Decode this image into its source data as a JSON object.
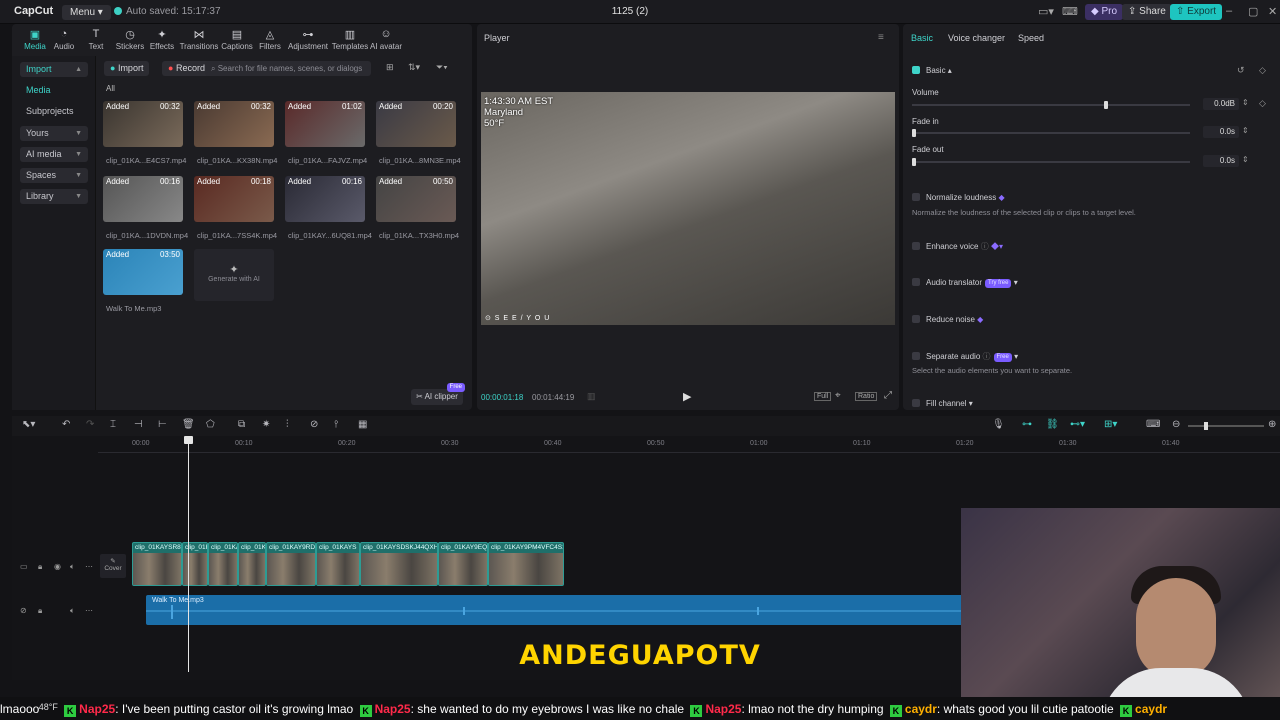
{
  "app": {
    "logo": "CapCut",
    "menu_label": "Menu",
    "saved_status": "Auto saved: 15:17:37",
    "project_title": "1125 (2)",
    "pro_label": "Pro",
    "share_label": "Share",
    "export_label": "Export"
  },
  "toolbar": {
    "items": [
      {
        "label": "Media",
        "icon": "media-icon"
      },
      {
        "label": "Audio",
        "icon": "audio-icon"
      },
      {
        "label": "Text",
        "icon": "text-icon"
      },
      {
        "label": "Stickers",
        "icon": "stickers-icon"
      },
      {
        "label": "Effects",
        "icon": "effects-icon"
      },
      {
        "label": "Transitions",
        "icon": "transitions-icon"
      },
      {
        "label": "Captions",
        "icon": "captions-icon"
      },
      {
        "label": "Filters",
        "icon": "filters-icon"
      },
      {
        "label": "Adjustment",
        "icon": "adjustment-icon"
      },
      {
        "label": "Templates",
        "icon": "templates-icon"
      },
      {
        "label": "AI avatar",
        "icon": "ai-avatar-icon"
      }
    ]
  },
  "sidebar": {
    "items": [
      "Import",
      "Media",
      "Subprojects",
      "Yours",
      "AI media",
      "Spaces",
      "Library"
    ]
  },
  "media": {
    "import_label": "Import",
    "record_label": "Record",
    "search_placeholder": "Search for file names, scenes, or dialogs",
    "filter_all": "All",
    "added_tag": "Added",
    "items": [
      {
        "name": "clip_01KA...E4CS7.mp4",
        "duration": "00:32"
      },
      {
        "name": "clip_01KA...KX38N.mp4",
        "duration": "00:32"
      },
      {
        "name": "clip_01KA...FAJVZ.mp4",
        "duration": "01:02"
      },
      {
        "name": "clip_01KA...8MN3E.mp4",
        "duration": "00:20"
      },
      {
        "name": "clip_01KA...1DVDN.mp4",
        "duration": "00:16"
      },
      {
        "name": "clip_01KA...7SS4K.mp4",
        "duration": "00:18"
      },
      {
        "name": "clip_01KAY...6UQ81.mp4",
        "duration": "00:16"
      },
      {
        "name": "clip_01KA...TX3H0.mp4",
        "duration": "00:50"
      },
      {
        "name": "Walk To Me.mp3",
        "duration": "03:50"
      }
    ],
    "generate_label": "Generate with AI",
    "ai_clipper_label": "AI clipper",
    "ai_clipper_badge": "Free"
  },
  "player": {
    "title": "Player",
    "stamp_time": "1:43:30 AM EST",
    "stamp_place": "Maryland",
    "stamp_temp": "50°F",
    "overlay_text": "⊙ S E E  / Y O U",
    "current_time": "00:00:01:18",
    "total_time": "00:01:44:19",
    "full_label": "Full",
    "ratio_label": "Ratio"
  },
  "props": {
    "tabs": [
      "Basic",
      "Voice changer",
      "Speed"
    ],
    "section": "Basic",
    "volume_label": "Volume",
    "volume_value": "0.0dB",
    "volume_level": 0.69,
    "fade_in_label": "Fade in",
    "fade_in_value": "0.0s",
    "fade_out_label": "Fade out",
    "fade_out_value": "0.0s",
    "normalize_label": "Normalize loudness",
    "normalize_desc": "Normalize the loudness of the selected clip or clips to a target level.",
    "enhance_label": "Enhance voice",
    "translator_label": "Audio translator",
    "translator_badge": "Try free",
    "reduce_label": "Reduce noise",
    "separate_label": "Separate audio",
    "separate_badge": "Free",
    "separate_desc": "Select the audio elements you want to separate.",
    "fill_label": "Fill channel"
  },
  "timeline": {
    "ruler": [
      "00:00",
      "00:10",
      "00:20",
      "00:30",
      "00:40",
      "00:50",
      "01:00",
      "01:10",
      "01:20",
      "01:30",
      "01:40"
    ],
    "cover_label": "Cover",
    "clips": [
      "clip_01KAYSR8E",
      "clip_01KA",
      "clip_01KA",
      "clip_01K",
      "clip_01KAY9RD",
      "clip_01KAYS",
      "clip_01KAYSDSKJ44QXH",
      "clip_01KAY9EQ",
      "clip_01KAY9PM4VFC4S1"
    ],
    "audio_name": "Walk To Me.mp3"
  },
  "overlay": {
    "watermark": "ANDEGUAPOTV"
  },
  "ticker": {
    "items": [
      {
        "user": "",
        "msg": "lmaooo"
      },
      {
        "user": "Nap25",
        "msg": ": I've been putting castor oil it's growing lmao"
      },
      {
        "user": "Nap25",
        "msg": ": she wanted to do my eyebrows I was like no chale"
      },
      {
        "user": "Nap25",
        "msg": ": lmao not the dry humping"
      },
      {
        "user": "caydr",
        "msg": ": whats good you lil cutie patootie"
      },
      {
        "user": "caydr",
        "msg": ""
      }
    ],
    "temp": "48°F"
  }
}
